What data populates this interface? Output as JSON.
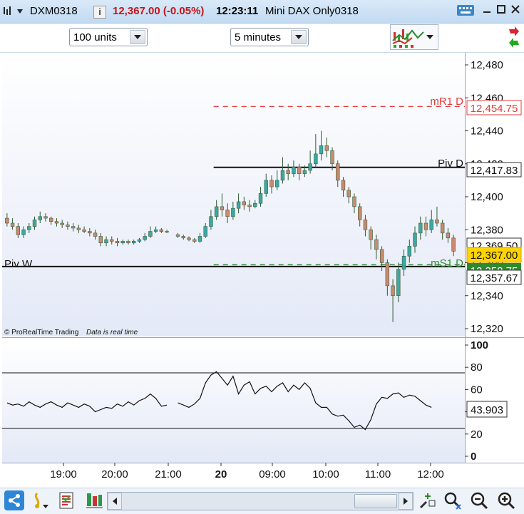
{
  "window": {
    "symbol": "DXM0318",
    "info_badge": "i",
    "price_change": "12,367.00 (-0.05%)",
    "time": "12:23:11",
    "instrument": "Mini DAX Only0318"
  },
  "toolbar": {
    "units_select": "100 units",
    "timeframe_select": "5 minutes"
  },
  "chart": {
    "price_axis_ticks": [
      "12,480",
      "12,460",
      "12,440",
      "12,420",
      "12,400",
      "12,380",
      "12,360",
      "12,340",
      "12,320"
    ],
    "levels": {
      "mr1_label": "mR1 D",
      "mr1_value": "12,454.75",
      "pivd_label": "Piv D",
      "pivd_value": "12,417.83",
      "ms1_label": "mS1 D",
      "ms1_value": "12,358.75",
      "pivw_label": "Piv W",
      "pivw_value": "12,357.67",
      "prev_close_value": "12,369.50",
      "last_price": "12,367.00"
    },
    "copyright": "© ProRealTime Trading",
    "realtime_note": "Data is real time",
    "colors": {
      "up": "#3aa9a3",
      "down": "#c98a70",
      "mr1": "#e63b3b",
      "ms1": "#2f8a2f",
      "price_badge": "#ffd400"
    }
  },
  "indicator": {
    "axis_ticks": [
      "100",
      "80",
      "60",
      "40",
      "20",
      "0"
    ],
    "value": "43.903",
    "upper_level": 75,
    "lower_level": 25
  },
  "time_axis": [
    "19:00",
    "20:00",
    "21:00",
    "20",
    "09:00",
    "10:00",
    "11:00",
    "12:00"
  ],
  "chart_data": {
    "type": "candlestick",
    "ylim": [
      12315,
      12488
    ],
    "levels": {
      "mR1 D": 12454.75,
      "Piv D": 12417.83,
      "mS1 D": 12358.75,
      "Piv W": 12357.67
    },
    "last_price": 12367.0,
    "candles": [
      [
        12387,
        12384,
        12390,
        12382
      ],
      [
        12384,
        12382,
        12387,
        12380
      ],
      [
        12382,
        12377,
        12384,
        12375
      ],
      [
        12377,
        12380,
        12382,
        12375
      ],
      [
        12380,
        12382,
        12384,
        12378
      ],
      [
        12382,
        12386,
        12388,
        12380
      ],
      [
        12386,
        12388,
        12391,
        12384
      ],
      [
        12388,
        12387,
        12390,
        12385
      ],
      [
        12387,
        12385,
        12388,
        12383
      ],
      [
        12385,
        12384,
        12387,
        12382
      ],
      [
        12384,
        12383,
        12386,
        12381
      ],
      [
        12383,
        12382,
        12385,
        12380
      ],
      [
        12382,
        12381,
        12384,
        12379
      ],
      [
        12381,
        12380,
        12383,
        12378
      ],
      [
        12380,
        12379,
        12382,
        12378
      ],
      [
        12379,
        12378,
        12381,
        12376
      ],
      [
        12378,
        12376,
        12380,
        12374
      ],
      [
        12376,
        12372,
        12378,
        12370
      ],
      [
        12372,
        12374,
        12376,
        12370
      ],
      [
        12374,
        12373,
        12376,
        12371
      ],
      [
        12373,
        12372,
        12375,
        12370
      ],
      [
        12372,
        12373,
        12374,
        12371
      ],
      [
        12373,
        12372,
        12374,
        12371
      ],
      [
        12372,
        12373,
        12374,
        12371
      ],
      [
        12373,
        12374,
        12375,
        12372
      ],
      [
        12374,
        12376,
        12378,
        12373
      ],
      [
        12376,
        12379,
        12382,
        12375
      ],
      [
        12379,
        12380,
        12382,
        12378
      ],
      [
        12380,
        12379,
        12381,
        12378
      ],
      [
        12379,
        12379,
        12380,
        12378
      ],
      null,
      [
        12377,
        12376,
        12378,
        12375
      ],
      [
        12376,
        12375,
        12377,
        12374
      ],
      [
        12375,
        12374,
        12376,
        12373
      ],
      [
        12374,
        12373,
        12375,
        12372
      ],
      [
        12373,
        12376,
        12378,
        12372
      ],
      [
        12376,
        12382,
        12384,
        12375
      ],
      [
        12382,
        12388,
        12392,
        12380
      ],
      [
        12388,
        12394,
        12398,
        12386
      ],
      [
        12394,
        12392,
        12402,
        12388
      ],
      [
        12392,
        12388,
        12396,
        12384
      ],
      [
        12388,
        12393,
        12397,
        12386
      ],
      [
        12393,
        12397,
        12402,
        12390
      ],
      [
        12397,
        12395,
        12400,
        12392
      ],
      [
        12395,
        12394,
        12398,
        12391
      ],
      [
        12394,
        12396,
        12398,
        12393
      ],
      [
        12396,
        12402,
        12406,
        12394
      ],
      [
        12402,
        12410,
        12414,
        12400
      ],
      [
        12410,
        12406,
        12413,
        12402
      ],
      [
        12406,
        12410,
        12416,
        12404
      ],
      [
        12410,
        12416,
        12424,
        12408
      ],
      [
        12416,
        12414,
        12420,
        12410
      ],
      [
        12414,
        12418,
        12422,
        12412
      ],
      [
        12418,
        12414,
        12420,
        12410
      ],
      [
        12414,
        12416,
        12419,
        12412
      ],
      [
        12416,
        12420,
        12428,
        12414
      ],
      [
        12420,
        12426,
        12438,
        12418
      ],
      [
        12426,
        12431,
        12440,
        12422
      ],
      [
        12431,
        12428,
        12436,
        12424
      ],
      [
        12428,
        12420,
        12430,
        12416
      ],
      [
        12420,
        12410,
        12422,
        12406
      ],
      [
        12410,
        12404,
        12412,
        12400
      ],
      [
        12404,
        12400,
        12406,
        12396
      ],
      [
        12400,
        12394,
        12402,
        12390
      ],
      [
        12394,
        12386,
        12396,
        12382
      ],
      [
        12386,
        12380,
        12389,
        12376
      ],
      [
        12380,
        12374,
        12382,
        12368
      ],
      [
        12374,
        12368,
        12377,
        12362
      ],
      [
        12368,
        12360,
        12370,
        12355
      ],
      [
        12360,
        12346,
        12362,
        12340
      ],
      [
        12346,
        12340,
        12350,
        12324
      ],
      [
        12340,
        12356,
        12360,
        12336
      ],
      [
        12356,
        12364,
        12368,
        12352
      ],
      [
        12364,
        12370,
        12374,
        12360
      ],
      [
        12370,
        12378,
        12382,
        12366
      ],
      [
        12378,
        12384,
        12388,
        12374
      ],
      [
        12384,
        12380,
        12388,
        12376
      ],
      [
        12380,
        12386,
        12392,
        12378
      ],
      [
        12386,
        12384,
        12394,
        12382
      ],
      [
        12384,
        12378,
        12386,
        12374
      ],
      [
        12378,
        12375,
        12381,
        12372
      ],
      [
        12375,
        12367,
        12377,
        12364
      ]
    ],
    "indicator_series": [
      48,
      46,
      47,
      45,
      49,
      46,
      44,
      47,
      49,
      46,
      44,
      48,
      46,
      44,
      47,
      45,
      40,
      42,
      44,
      43,
      47,
      45,
      49,
      46,
      50,
      52,
      56,
      52,
      45,
      46,
      null,
      48,
      46,
      44,
      47,
      52,
      66,
      73,
      76,
      70,
      64,
      72,
      56,
      64,
      67,
      56,
      61,
      63,
      58,
      63,
      66,
      58,
      64,
      60,
      66,
      61,
      48,
      44,
      44,
      38,
      36,
      37,
      32,
      26,
      28,
      24,
      33,
      47,
      53,
      52,
      56,
      57,
      53,
      55,
      54,
      50,
      46,
      44
    ]
  }
}
